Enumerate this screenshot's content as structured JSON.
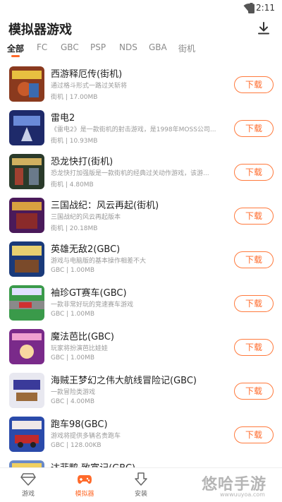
{
  "status_bar": {
    "time": "2:11"
  },
  "header": {
    "title": "模拟器游戏"
  },
  "tabs": [
    {
      "label": "全部",
      "active": true
    },
    {
      "label": "FC"
    },
    {
      "label": "GBC"
    },
    {
      "label": "PSP"
    },
    {
      "label": "NDS"
    },
    {
      "label": "GBA"
    },
    {
      "label": "街机"
    }
  ],
  "games": [
    {
      "name": "西游释厄传(街机)",
      "desc": "通过格斗形式一路过关斩将",
      "meta": "街机 | 17.00MB",
      "button": "下载"
    },
    {
      "name": "雷电2",
      "desc": "《雷电2》是一款街机的射击游戏，是1998年MOSS公司...",
      "meta": "街机 | 10.93MB",
      "button": "下载"
    },
    {
      "name": "恐龙快打(街机)",
      "desc": "恐龙快打加强版是一款街机的经典过关动作游戏，该游...",
      "meta": "街机 | 4.80MB",
      "button": "下载"
    },
    {
      "name": "三国战纪：风云再起(街机)",
      "desc": "三国战纪的风云再起版本",
      "meta": "街机 | 20.18MB",
      "button": "下载"
    },
    {
      "name": "英雄无敌2(GBC)",
      "desc": "游戏与电脑版的基本操作相差不大",
      "meta": "GBC | 1.00MB",
      "button": "下载"
    },
    {
      "name": "袖珍GT赛车(GBC)",
      "desc": "一款非常好玩的竞速赛车游戏",
      "meta": "GBC | 1.00MB",
      "button": "下载"
    },
    {
      "name": "魔法芭比(GBC)",
      "desc": "玩家将扮演芭比娃娃",
      "meta": "GBC | 1.00MB",
      "button": "下载"
    },
    {
      "name": "海贼王梦幻之伟大航线冒险记(GBC)",
      "desc": "一款冒险类游戏",
      "meta": "GBC | 4.00MB",
      "button": "下载"
    },
    {
      "name": "跑车98(GBC)",
      "desc": "游戏将提供多辆名贵跑车",
      "meta": "GBC | 128.00KB",
      "button": "下载"
    },
    {
      "name": "达菲鸭 致富记(GBC)"
    }
  ],
  "bottom_nav": [
    {
      "label": "游戏",
      "icon": "diamond-icon"
    },
    {
      "label": "模拟器",
      "icon": "gamepad-icon",
      "active": true
    },
    {
      "label": "安装",
      "icon": "install-arrow-icon"
    }
  ],
  "watermark": {
    "text": "悠哈手游",
    "sub": "wwwuuyoa.com"
  },
  "colors": {
    "accent": "#ff6a2a",
    "text": "#222222",
    "muted": "#9a9a9a"
  }
}
